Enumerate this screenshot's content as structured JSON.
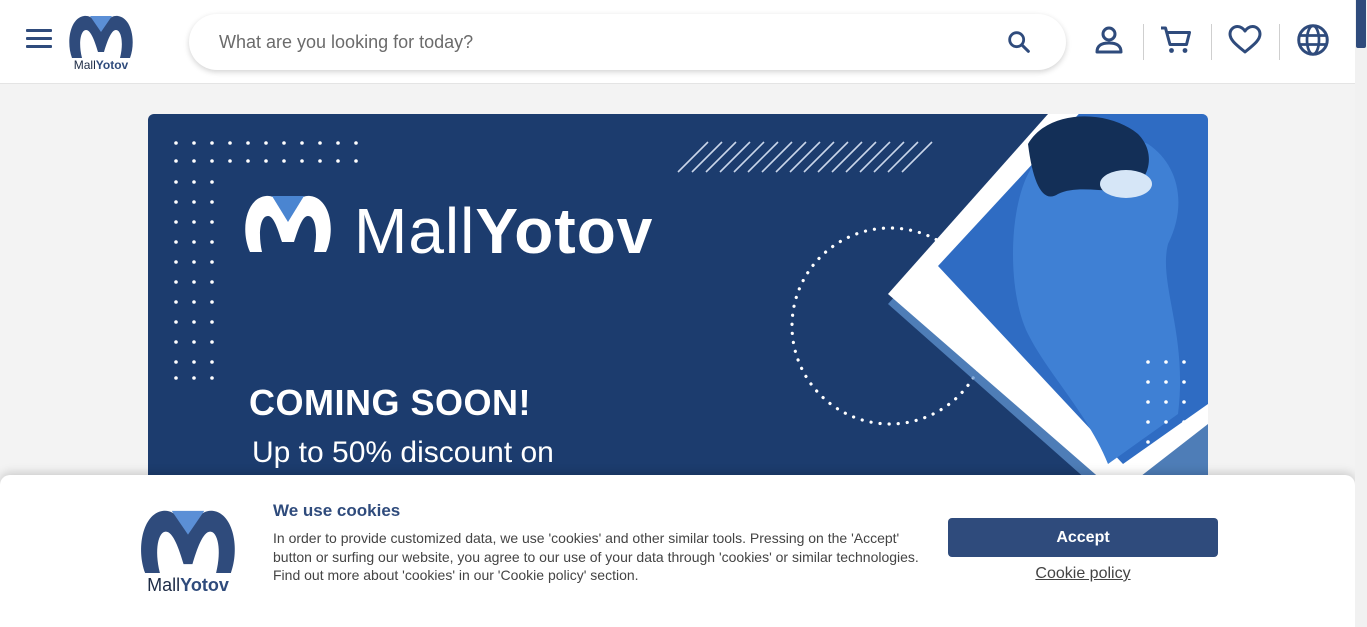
{
  "header": {
    "logo_light": "Mall",
    "logo_bold": "Yotov",
    "search_placeholder": "What are you looking for today?"
  },
  "banner": {
    "brand_light": "Mall",
    "brand_bold": "Yotov",
    "headline": "COMING SOON!",
    "subline": "Up to 50% discount on"
  },
  "cookie": {
    "logo_light": "Mall",
    "logo_bold": "Yotov",
    "title": "We use cookies",
    "text": "In order to provide customized data, we use 'cookies' and other similar tools. Pressing on the 'Accept' button or surfing our website, you agree to our use of your data through 'cookies' or similar technologies. Find out more about 'cookies' in our 'Cookie policy' section.",
    "accept_label": "Accept",
    "policy_label": "Cookie policy"
  },
  "colors": {
    "brand": "#2f4b7c",
    "banner_bg": "#1c3c6e",
    "accent_light": "#5b8fd6"
  },
  "icons": [
    "menu-icon",
    "search-icon",
    "user-icon",
    "cart-icon",
    "heart-icon",
    "globe-icon"
  ]
}
